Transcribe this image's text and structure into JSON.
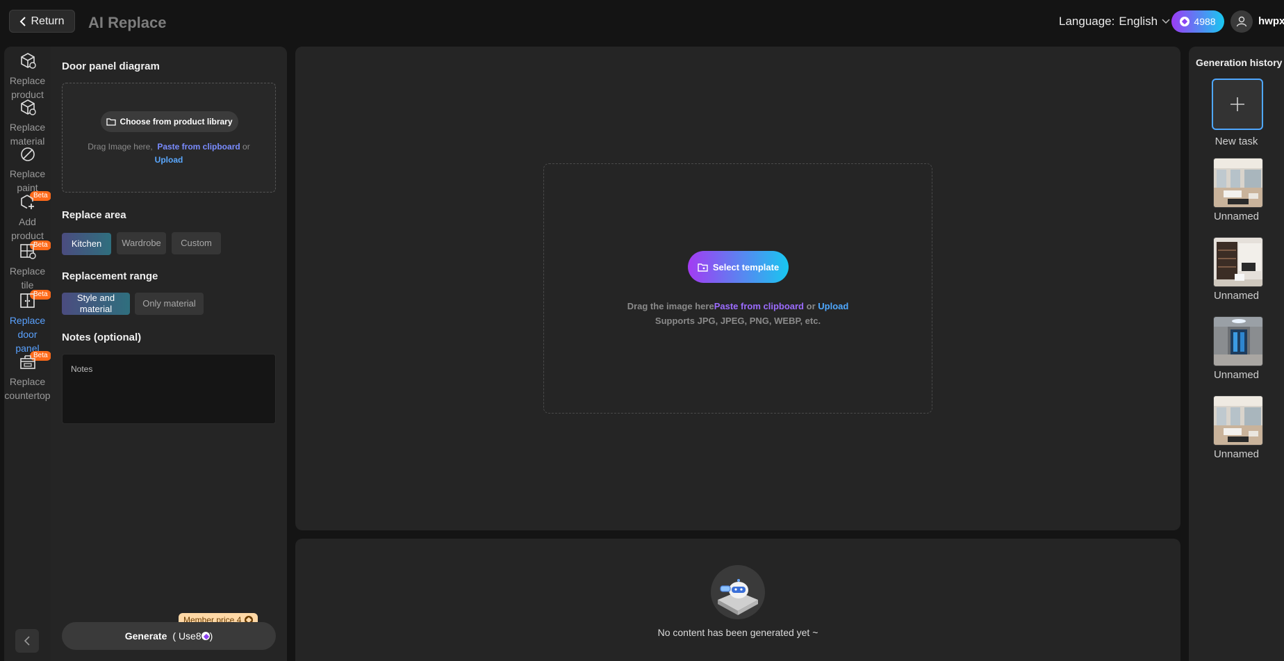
{
  "header": {
    "return_label": "Return",
    "title": "AI Replace",
    "language_label": "Language:",
    "language_value": "English",
    "credits": "4988",
    "username": "hwpx"
  },
  "sidebar": {
    "items": [
      {
        "label_1": "Replace",
        "label_2": "product",
        "icon": "replace-product-icon"
      },
      {
        "label_1": "Replace",
        "label_2": "material",
        "icon": "replace-material-icon"
      },
      {
        "label_1": "Replace",
        "label_2": "paint",
        "icon": "replace-paint-icon"
      },
      {
        "label_1": "Add",
        "label_2": "product",
        "icon": "add-product-icon",
        "badge": "Beta"
      },
      {
        "label_1": "Replace",
        "label_2": "tile",
        "icon": "replace-tile-icon",
        "badge": "Beta"
      },
      {
        "label_1": "Replace",
        "label_2": "door",
        "label_3": "panel",
        "icon": "replace-door-panel-icon",
        "badge": "Beta",
        "active": true
      },
      {
        "label_1": "Replace",
        "label_2": "countertop",
        "icon": "replace-countertop-icon",
        "badge": "Beta"
      }
    ]
  },
  "panel": {
    "diagram_title": "Door panel diagram",
    "library_button": "Choose from product library",
    "drag_text": "Drag Image here,",
    "paste_link": "Paste from clipboard",
    "or_text": "or",
    "upload_link": "Upload",
    "replace_area_title": "Replace area",
    "replace_area_options": [
      "Kitchen",
      "Wardrobe",
      "Custom"
    ],
    "replace_area_selected": "Kitchen",
    "range_title": "Replacement range",
    "range_option_1": "Style and material",
    "range_option_2": "Only material",
    "range_selected": "Style and material",
    "notes_title": "Notes (optional)",
    "notes_placeholder": "Notes",
    "member_price": "Member price 4",
    "generate_label": "Generate",
    "generate_cost_prefix": "( Use8",
    "generate_cost_suffix": ")"
  },
  "canvas": {
    "select_template": "Select template",
    "drag_text": "Drag the image here",
    "paste_link": "Paste from clipboard",
    "or_text": "or",
    "upload_link": "Upload",
    "formats": "Supports JPG, JPEG, PNG, WEBP, etc."
  },
  "results": {
    "empty_text": "No content has been generated yet ~"
  },
  "history": {
    "title": "Generation history",
    "new_task": "New task",
    "items": [
      {
        "label": "Unnamed"
      },
      {
        "label": "Unnamed"
      },
      {
        "label": "Unnamed"
      },
      {
        "label": "Unnamed"
      }
    ]
  },
  "colors": {
    "accent_blue": "#4fa8ff",
    "accent_purple": "#9b3cf5",
    "beta_orange": "#ff6a1a",
    "member_tag": "#ffd8a6"
  }
}
